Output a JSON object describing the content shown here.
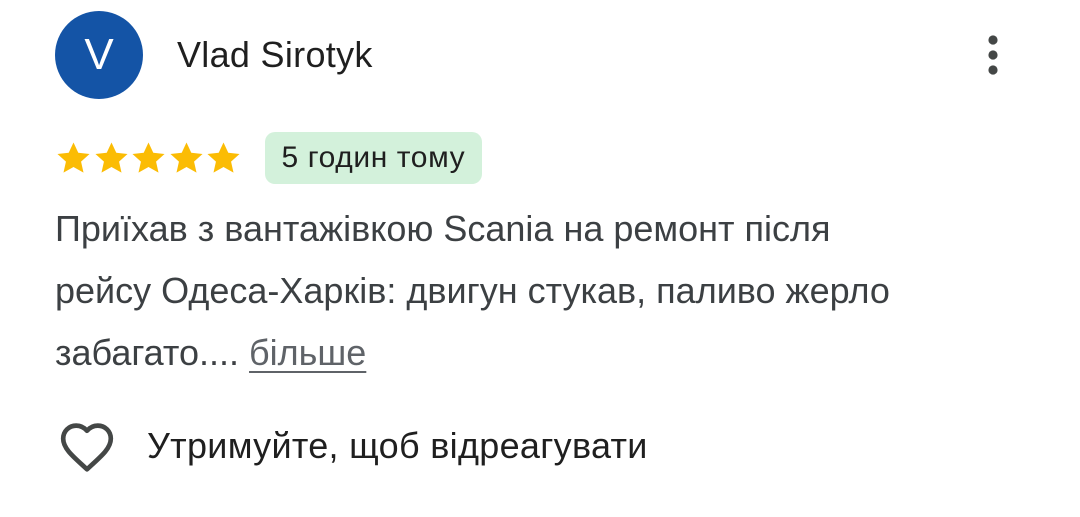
{
  "review": {
    "author": {
      "avatar_letter": "V",
      "avatar_color": "#1454a6",
      "name": "Vlad Sirotyk"
    },
    "menu_icon": "more-vert-icon",
    "rating": {
      "stars": 5,
      "max": 5,
      "star_color": "#fbbc04"
    },
    "time_ago": "5 годин тому",
    "badge_color": "#d3f1db",
    "text_line_1": "Приїхав з вантажівкою Scania на ремонт після",
    "text_line_2": "рейсу Одеса-Харків: двигун стукав, паливо жерло",
    "text_line_3": "забагато.... ",
    "more_label": "більше",
    "react": {
      "icon": "heart-outline-icon",
      "label": "Утримуйте, щоб відреагувати"
    }
  }
}
